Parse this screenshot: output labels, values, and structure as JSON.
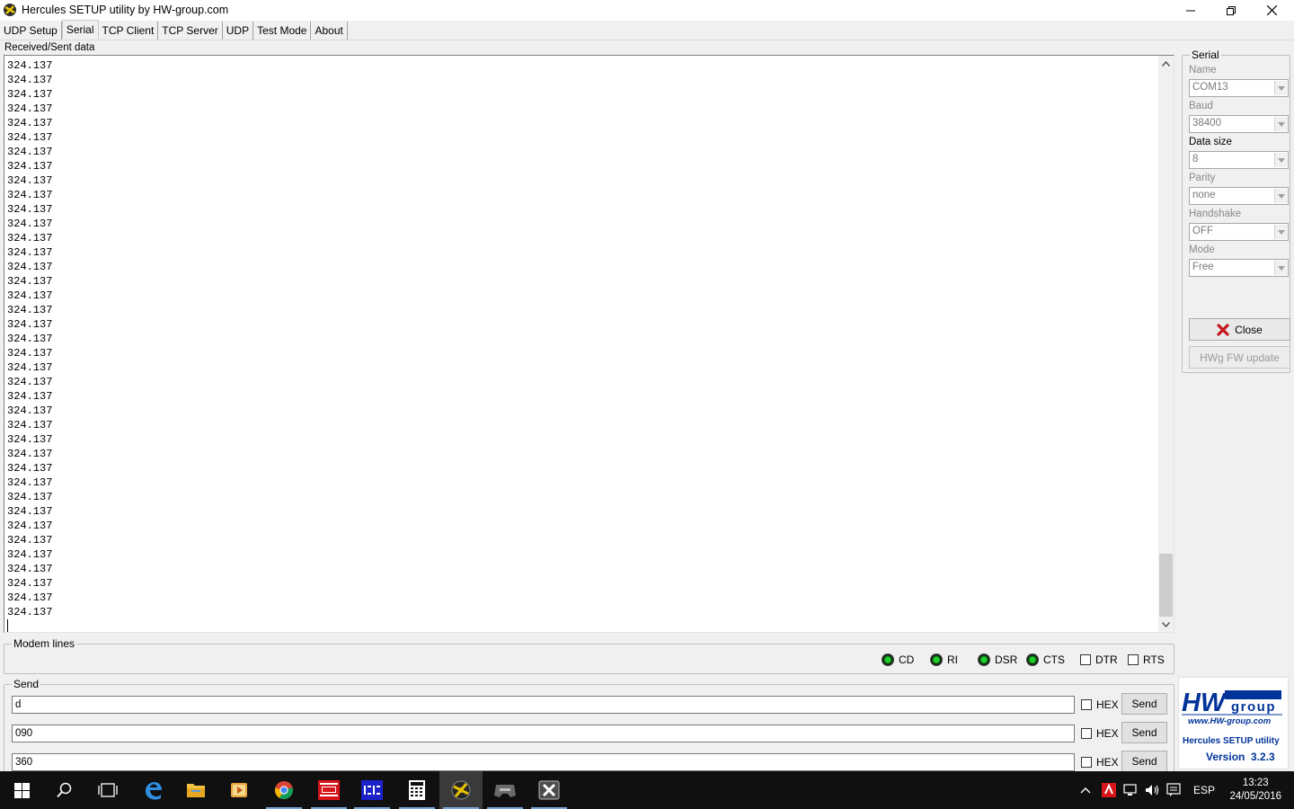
{
  "window": {
    "title": "Hercules SETUP utility by HW-group.com"
  },
  "tabs": [
    {
      "label": "UDP Setup",
      "active": false
    },
    {
      "label": "Serial",
      "active": true
    },
    {
      "label": "TCP Client",
      "active": false
    },
    {
      "label": "TCP Server",
      "active": false
    },
    {
      "label": "UDP",
      "active": false
    },
    {
      "label": "Test Mode",
      "active": false
    },
    {
      "label": "About",
      "active": false
    }
  ],
  "received": {
    "label": "Received/Sent data",
    "lines": [
      "324.137",
      "324.137",
      "324.137",
      "324.137",
      "324.137",
      "324.137",
      "324.137",
      "324.137",
      "324.137",
      "324.137",
      "324.137",
      "324.137",
      "324.137",
      "324.137",
      "324.137",
      "324.137",
      "324.137",
      "324.137",
      "324.137",
      "324.137",
      "324.137",
      "324.137",
      "324.137",
      "324.137",
      "324.137",
      "324.137",
      "324.137",
      "324.137",
      "324.137",
      "324.137",
      "324.137",
      "324.137",
      "324.137",
      "324.137",
      "324.137",
      "324.137",
      "324.137",
      "324.137",
      "324.137"
    ]
  },
  "modem": {
    "label": "Modem lines",
    "leds": [
      {
        "label": "CD"
      },
      {
        "label": "RI"
      },
      {
        "label": "DSR"
      },
      {
        "label": "CTS"
      }
    ],
    "checks": [
      {
        "label": "DTR"
      },
      {
        "label": "RTS"
      }
    ]
  },
  "send": {
    "label": "Send",
    "rows": [
      {
        "value": "d",
        "hex_label": "HEX",
        "button": "Send"
      },
      {
        "value": "090",
        "hex_label": "HEX",
        "button": "Send"
      },
      {
        "value": "360",
        "hex_label": "HEX",
        "button": "Send"
      }
    ]
  },
  "serial": {
    "label": "Serial",
    "fields": [
      {
        "label": "Name",
        "value": "COM13",
        "enabled": false
      },
      {
        "label": "Baud",
        "value": "38400",
        "enabled": false
      },
      {
        "label": "Data size",
        "value": "8",
        "enabled": true
      },
      {
        "label": "Parity",
        "value": "none",
        "enabled": false
      },
      {
        "label": "Handshake",
        "value": "OFF",
        "enabled": false
      },
      {
        "label": "Mode",
        "value": "Free",
        "enabled": false
      }
    ],
    "close_button": "Close",
    "fw_button": "HWg FW update"
  },
  "logo": {
    "brand_hw": "HW",
    "brand_group": "group",
    "url": "www.HW-group.com",
    "product": "Hercules SETUP utility",
    "version": "Version  3.2.3"
  },
  "taskbar": {
    "language": "ESP",
    "time": "13:23",
    "date": "24/05/2016",
    "apps": [
      "start-icon",
      "search-icon",
      "task-view-icon",
      "edge-icon",
      "file-explorer-icon",
      "media-player-icon",
      "chrome-icon",
      "ares-icon",
      "isis-icon",
      "calculator-icon",
      "hercules-icon",
      "xbox-icon",
      "x-app-icon"
    ]
  },
  "colors": {
    "accent_blue": "#003399",
    "led_green": "#1fcf2c",
    "close_red": "#c8161d",
    "taskbar": "#101010"
  }
}
